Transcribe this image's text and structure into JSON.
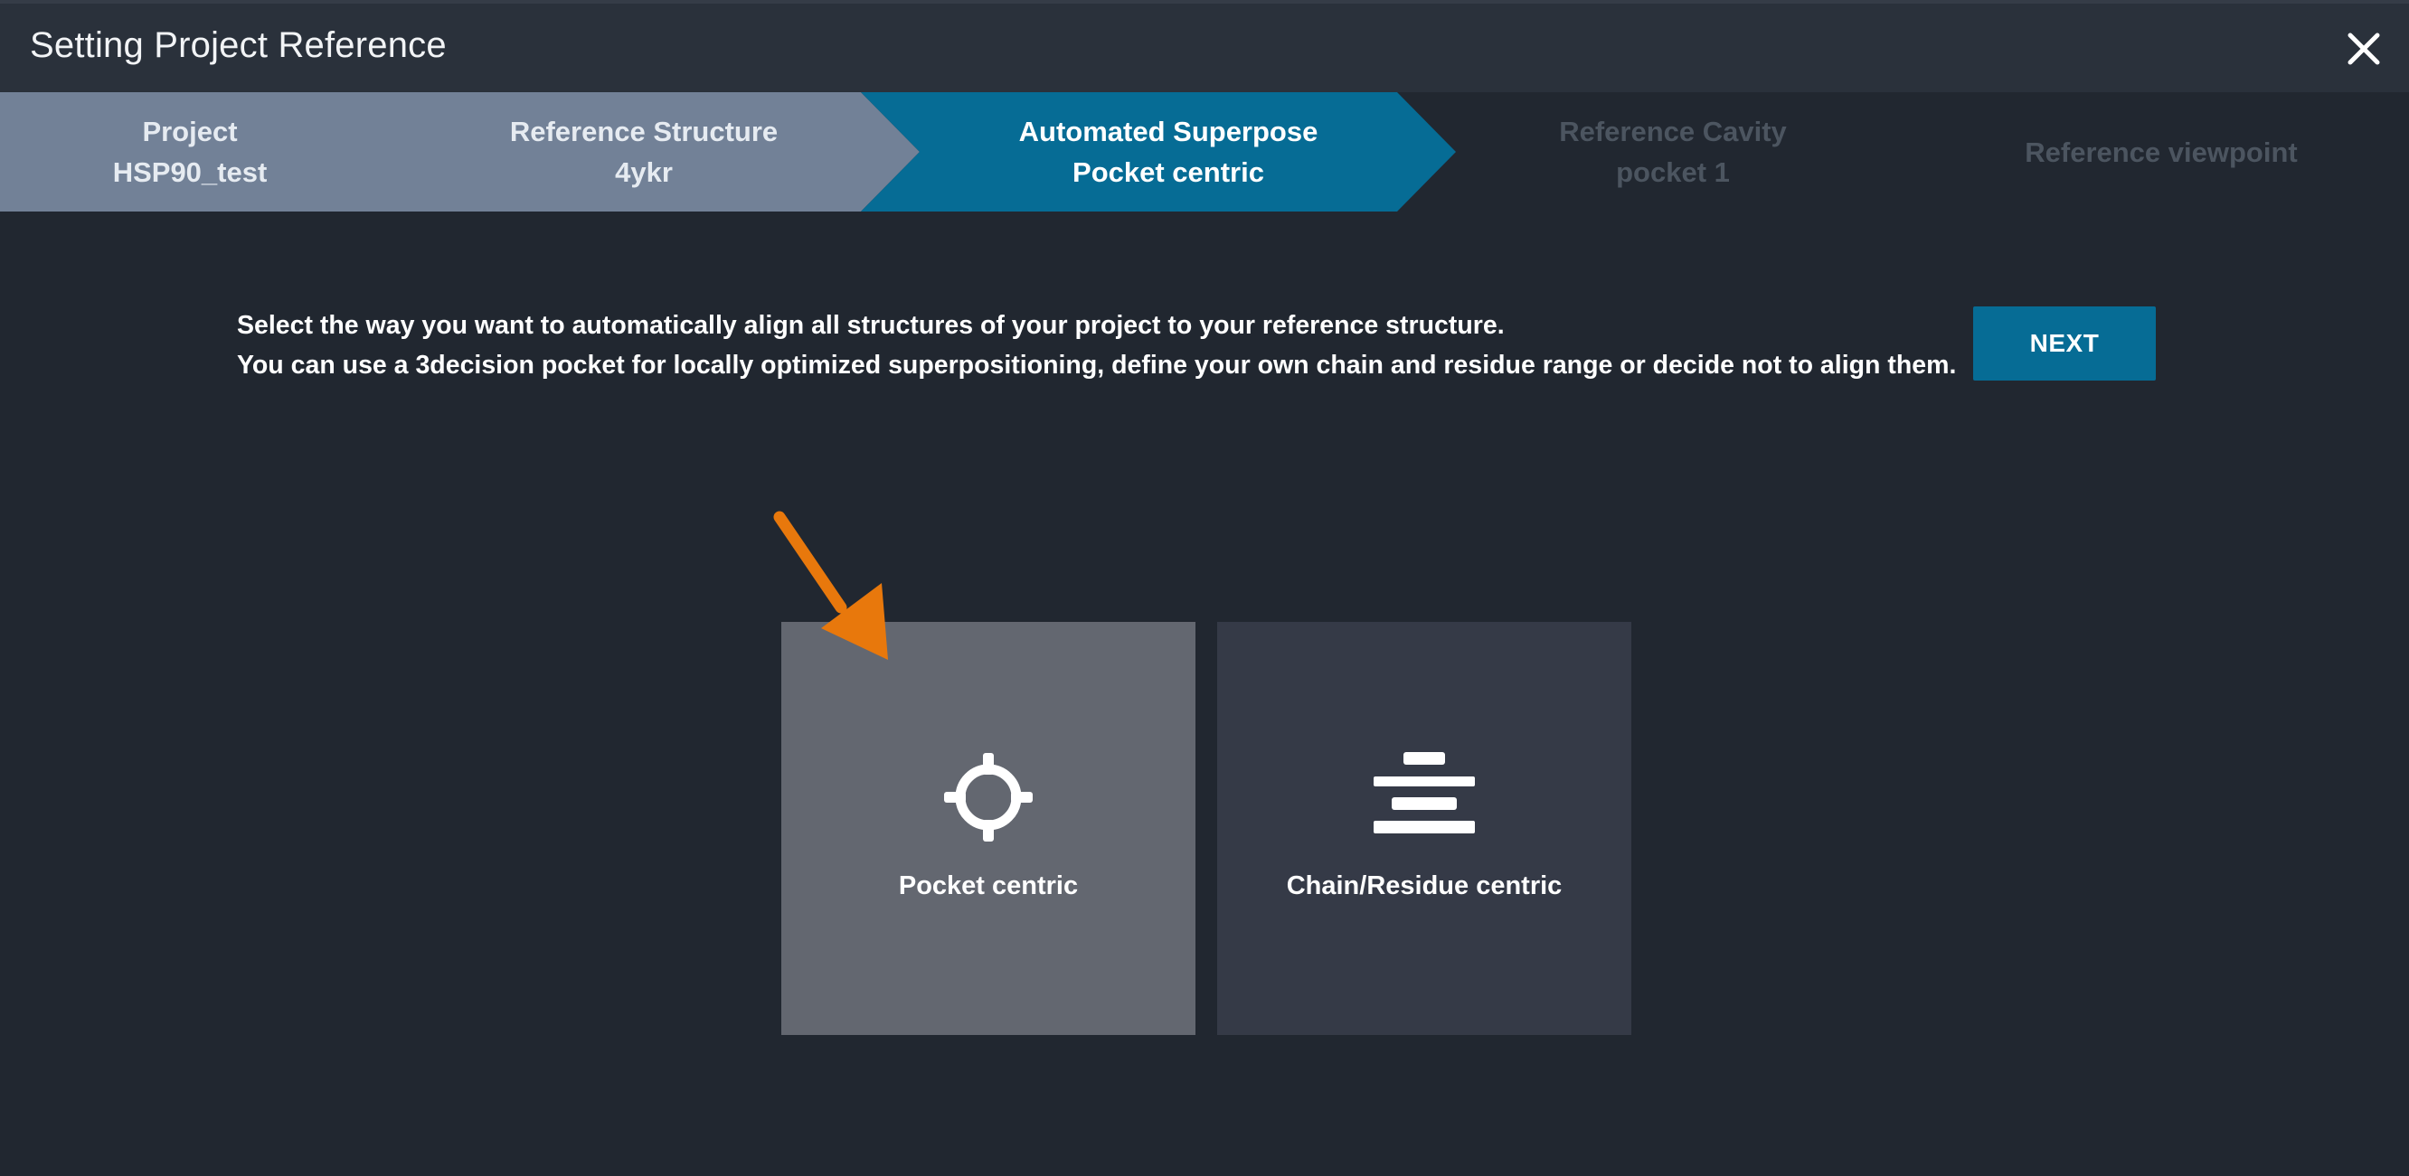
{
  "dialog": {
    "title": "Setting Project Reference",
    "close_icon": "close-icon"
  },
  "stepper": {
    "steps": [
      {
        "name": "Project",
        "value": "HSP90_test",
        "state": "done"
      },
      {
        "name": "Reference Structure",
        "value": "4ykr",
        "state": "done"
      },
      {
        "name": "Automated Superpose",
        "value": "Pocket centric",
        "state": "active"
      },
      {
        "name": "Reference Cavity",
        "value": "pocket 1",
        "state": "todo"
      },
      {
        "name": "Reference viewpoint",
        "value": "",
        "state": "todo"
      }
    ]
  },
  "instructions": {
    "line1": "Select the way you want to automatically align all structures of your project to your reference structure.",
    "line2": "You can use a 3decision pocket for locally optimized superpositioning, define your own chain and residue range or decide not to align them."
  },
  "next_button": {
    "label": "NEXT"
  },
  "options": [
    {
      "label": "Pocket centric",
      "icon": "crosshair-icon",
      "selected": true
    },
    {
      "label": "Chain/Residue centric",
      "icon": "stacked-bars-icon",
      "selected": false
    }
  ],
  "colors": {
    "background": "#212730",
    "titlebar": "#2a313b",
    "step_done": "#728197",
    "step_active": "#066c95",
    "button": "#066c95",
    "card_selected": "#636770",
    "card_unselected": "#353a47",
    "arrow": "#e8780c"
  }
}
